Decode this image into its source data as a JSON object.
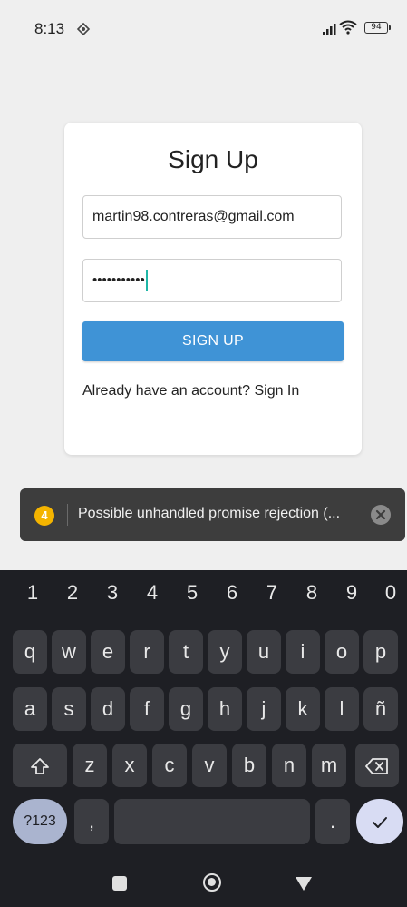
{
  "status_bar": {
    "time": "8:13",
    "battery": "94",
    "icons": [
      "app-notification-icon",
      "signal-icon",
      "wifi-icon",
      "battery-icon"
    ]
  },
  "signup_card": {
    "title": "Sign Up",
    "email_value": "martin98.contreras@gmail.com",
    "password_value": "•••••••••••",
    "button_label": "SIGN UP",
    "signin_prompt": "Already have an account? Sign In"
  },
  "toast": {
    "count": "4",
    "message": "Possible unhandled promise rejection (...",
    "count_color": "#f4b400"
  },
  "keyboard": {
    "number_row": [
      "1",
      "2",
      "3",
      "4",
      "5",
      "6",
      "7",
      "8",
      "9",
      "0"
    ],
    "row_q": [
      "q",
      "w",
      "e",
      "r",
      "t",
      "y",
      "u",
      "i",
      "o",
      "p"
    ],
    "row_a": [
      "a",
      "s",
      "d",
      "f",
      "g",
      "h",
      "j",
      "k",
      "l",
      "ñ"
    ],
    "row_z": [
      "z",
      "x",
      "c",
      "v",
      "b",
      "n",
      "m"
    ],
    "sym_label": "?123",
    "comma": ",",
    "period": "."
  },
  "colors": {
    "accent": "#3f93d6",
    "caret": "#1fb6a6",
    "keyboard_bg": "#1e1f24"
  }
}
